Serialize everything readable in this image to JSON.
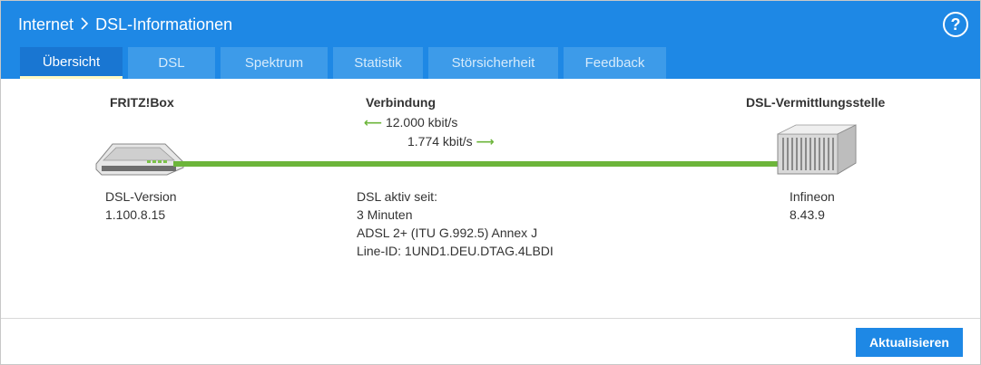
{
  "header": {
    "breadcrumb_root": "Internet",
    "breadcrumb_sep": ">",
    "breadcrumb_page": "DSL-Informationen",
    "help_label": "?"
  },
  "tabs": [
    {
      "label": "Übersicht",
      "active": true
    },
    {
      "label": "DSL",
      "active": false
    },
    {
      "label": "Spektrum",
      "active": false
    },
    {
      "label": "Statistik",
      "active": false
    },
    {
      "label": "Störsicherheit",
      "active": false
    },
    {
      "label": "Feedback",
      "active": false
    }
  ],
  "left": {
    "heading": "FRITZ!Box",
    "version_label": "DSL-Version",
    "version_value": "1.100.8.15"
  },
  "middle": {
    "heading": "Verbindung",
    "downstream": "12.000 kbit/s",
    "upstream": "1.774 kbit/s",
    "status_label": "DSL aktiv seit:",
    "status_duration": "3 Minuten",
    "standard": "ADSL 2+ (ITU G.992.5) Annex J",
    "line_id": "Line-ID: 1UND1.DEU.DTAG.4LBDI"
  },
  "right": {
    "heading": "DSL-Vermittlungsstelle",
    "vendor": "Infineon",
    "version": "8.43.9"
  },
  "footer": {
    "refresh_label": "Aktualisieren"
  },
  "colors": {
    "header_blue": "#1e88e5",
    "line_green": "#6cb53a"
  }
}
